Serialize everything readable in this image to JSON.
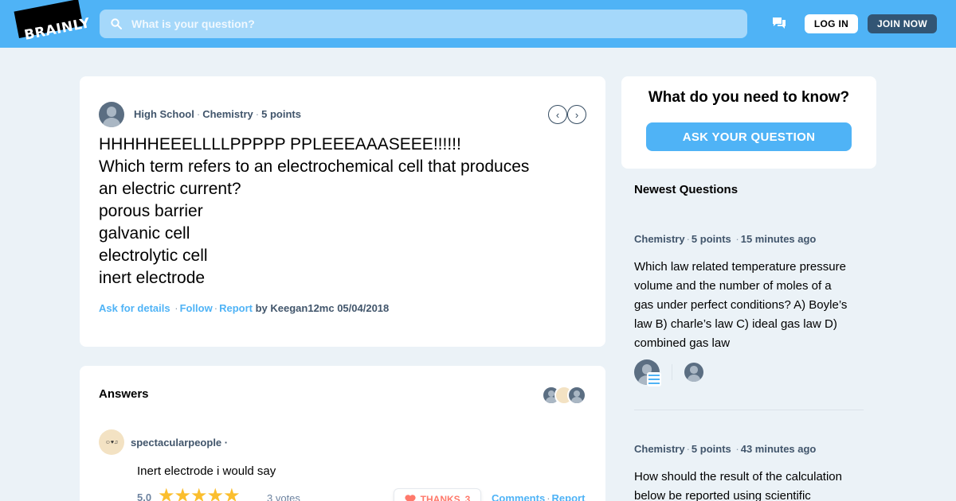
{
  "header": {
    "logo": "BRAINLY",
    "search_placeholder": "What is your question?",
    "login_label": "LOG IN",
    "join_label": "JOIN NOW",
    "accent_color": "#4fb3f6"
  },
  "question": {
    "level": "High School",
    "subject": "Chemistry",
    "points": "5 points",
    "lines": [
      "HHHHHEEELLLLPPPPP PPLEEEAAASEEE!!!!!!",
      "Which term refers to an electrochemical cell that produces",
      "an electric current?",
      "porous barrier",
      "galvanic cell",
      "electrolytic cell",
      "inert electrode"
    ],
    "ask_details": "Ask for details",
    "follow": "Follow",
    "report": "Report",
    "by_line": "by Keegan12mc 05/04/2018"
  },
  "answers": {
    "title": "Answers",
    "user": "spectacularpeople",
    "avatar_text": "☺♥♫",
    "text": "Inert electrode i would say",
    "rating": "5.0",
    "stars": "★★★★★",
    "votes": "3 votes",
    "thanks_label": "THANKS",
    "thanks_count": "3",
    "comments": "Comments",
    "report": "Report"
  },
  "ask_box": {
    "title": "What do you need to know?",
    "button": "ASK YOUR QUESTION"
  },
  "newest": {
    "title": "Newest Questions",
    "items": [
      {
        "subject": "Chemistry",
        "points": "5 points",
        "time": "15 minutes ago",
        "lines": [
          "Which law related temperature pressure",
          "volume and the number of moles of a",
          "gas under perfect conditions? A) Boyle’s",
          "law B) charle’s law C) ideal gas law D)",
          "combined gas law"
        ]
      },
      {
        "subject": "Chemistry",
        "points": "5 points",
        "time": "43 minutes ago",
        "lines": [
          "How should the result of the calculation",
          "below be reported using scientific"
        ]
      }
    ]
  }
}
